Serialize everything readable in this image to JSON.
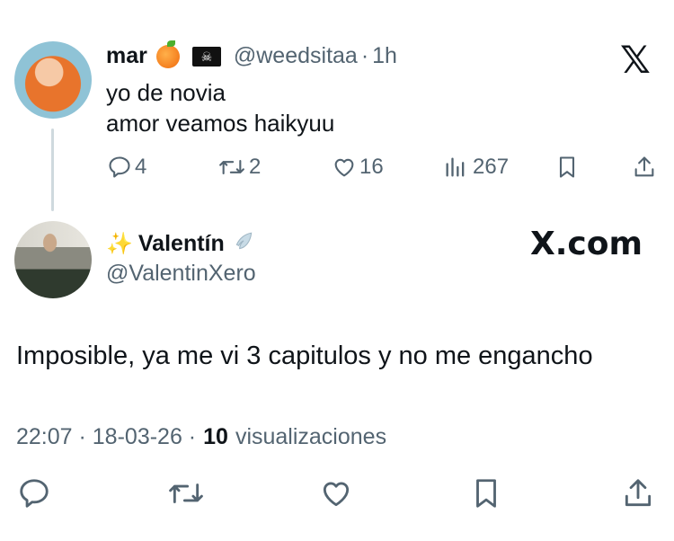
{
  "parent_tweet": {
    "author_name": "mar",
    "author_handle": "@weedsitaa",
    "time": "1h",
    "text_line1": "yo de novia",
    "text_line2": "amor veamos haikyuu",
    "stats": {
      "replies": "4",
      "retweets": "2",
      "likes": "16",
      "views": "267"
    }
  },
  "reply_tweet": {
    "author_name": "Valentín",
    "author_handle": "@ValentinXero",
    "brand": "X.com",
    "text": "Imposible, ya me vi 3 capitulos y no me engancho",
    "date_time": "22:07 · 18-03-26 ·",
    "views_count": "10",
    "views_label": "visualizaciones"
  },
  "icons": [
    "reply-icon",
    "retweet-icon",
    "like-icon",
    "views-icon",
    "bookmark-icon",
    "share-icon",
    "x-logo-icon"
  ],
  "colors": {
    "text": "#0f1419",
    "muted": "#536471",
    "line": "#cfd9de"
  }
}
